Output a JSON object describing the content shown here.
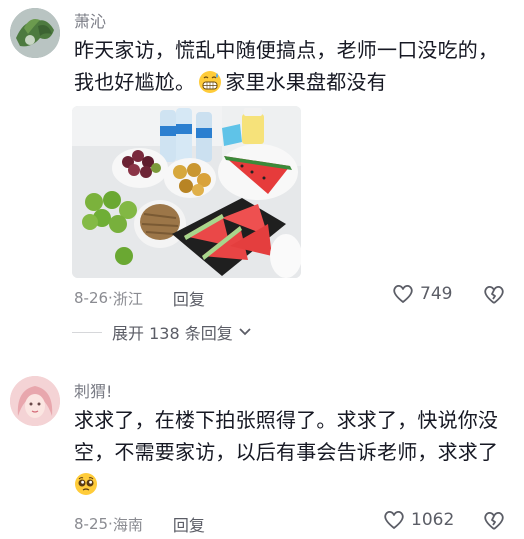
{
  "comments": [
    {
      "username": "萧沁",
      "text_line1": "昨天家访，慌乱中随便搞点，老师一口没吃的，",
      "text_line2_before": "我也好尴尬。",
      "text_line2_after": "家里水果盘都没有",
      "emoji": "grimacing-sweat-emoji",
      "date": "8-26",
      "location": "浙江",
      "reply_label": "回复",
      "likes": "749",
      "replies_toggle": "展开 138 条回复"
    },
    {
      "username": "刺猬!",
      "text_line1": "求求了，在楼下拍张照得了。求求了，快说你没",
      "text_line2": "空，不需要家访，以后有事会告诉老师，求求了",
      "emoji": "pleading-face-emoji",
      "date": "8-25",
      "location": "海南",
      "reply_label": "回复",
      "likes": "1062"
    }
  ],
  "separator": "·",
  "colors": {
    "text": "#161823",
    "meta": "#8a8b91",
    "username": "#7a7c85"
  }
}
